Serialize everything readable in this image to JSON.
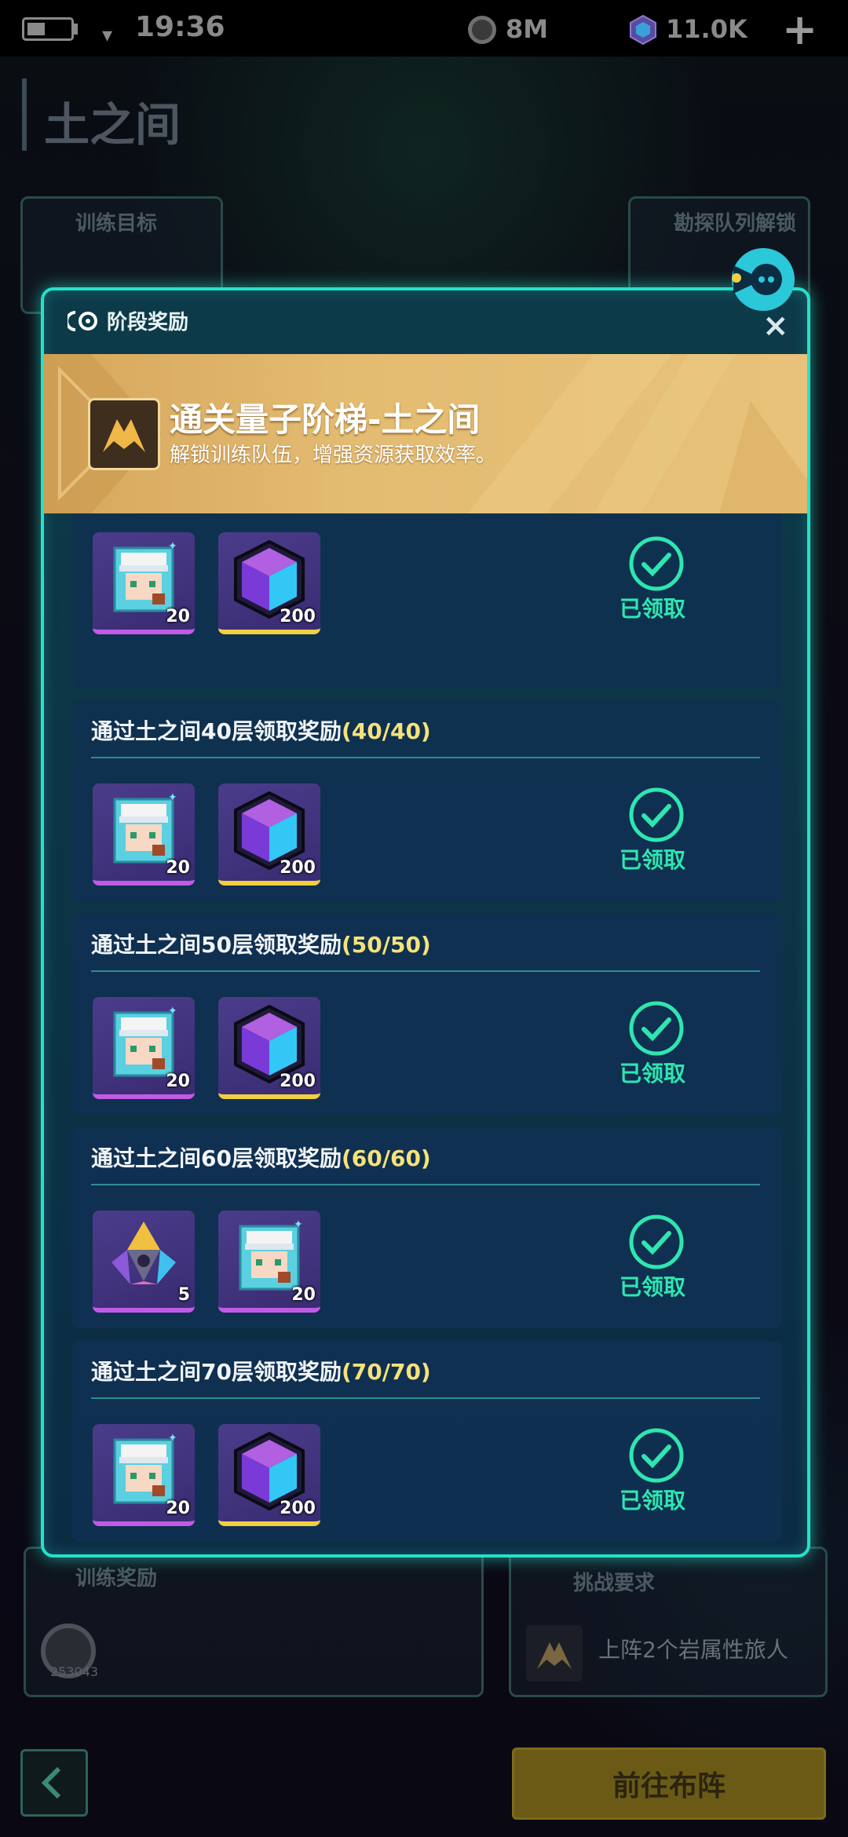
{
  "status_bar": {
    "time": "19:36",
    "resource1_value": "8M",
    "resource2_value": "11.0K",
    "plus_label": "+"
  },
  "background": {
    "page_title": "土之间",
    "panel_train_target": "训练目标",
    "panel_team_unlock": "勘探队列解锁",
    "panel_train_reward": "训练奖励",
    "panel_challenge_req": "挑战要求",
    "challenge_req_text": "上阵2个岩属性旅人",
    "coin_value": "253043",
    "go_button": "前往布阵"
  },
  "modal": {
    "title": "阶段奖励",
    "close_label": "×",
    "banner": {
      "title": "通关量子阶梯-土之间",
      "subtitle": "解锁训练队伍，增强资源获取效率。"
    },
    "claimed_label": "已领取",
    "cards": [
      {
        "title": "",
        "progress": "",
        "rewards": [
          {
            "icon": "character-ticket-icon",
            "qty": "20",
            "rarity": "purple"
          },
          {
            "icon": "cube-crystal-icon",
            "qty": "200",
            "rarity": "gold"
          }
        ]
      },
      {
        "title": "通过土之间40层领取奖励",
        "progress": "(40/40)",
        "rewards": [
          {
            "icon": "character-ticket-icon",
            "qty": "20",
            "rarity": "purple"
          },
          {
            "icon": "cube-crystal-icon",
            "qty": "200",
            "rarity": "gold"
          }
        ]
      },
      {
        "title": "通过土之间50层领取奖励",
        "progress": "(50/50)",
        "rewards": [
          {
            "icon": "character-ticket-icon",
            "qty": "20",
            "rarity": "purple"
          },
          {
            "icon": "cube-crystal-icon",
            "qty": "200",
            "rarity": "gold"
          }
        ]
      },
      {
        "title": "通过土之间60层领取奖励",
        "progress": "(60/60)",
        "rewards": [
          {
            "icon": "prism-shard-icon",
            "qty": "5",
            "rarity": "purple"
          },
          {
            "icon": "character-ticket-icon",
            "qty": "20",
            "rarity": "purple"
          }
        ]
      },
      {
        "title": "通过土之间70层领取奖励",
        "progress": "(70/70)",
        "rewards": [
          {
            "icon": "character-ticket-icon",
            "qty": "20",
            "rarity": "purple"
          },
          {
            "icon": "cube-crystal-icon",
            "qty": "200",
            "rarity": "gold"
          }
        ]
      }
    ]
  },
  "colors": {
    "accent_cyan": "#27e0c9",
    "claimed_green": "#2ee6b0",
    "progress_yellow": "#f6e27a",
    "banner_gold": "#e3bb71"
  }
}
